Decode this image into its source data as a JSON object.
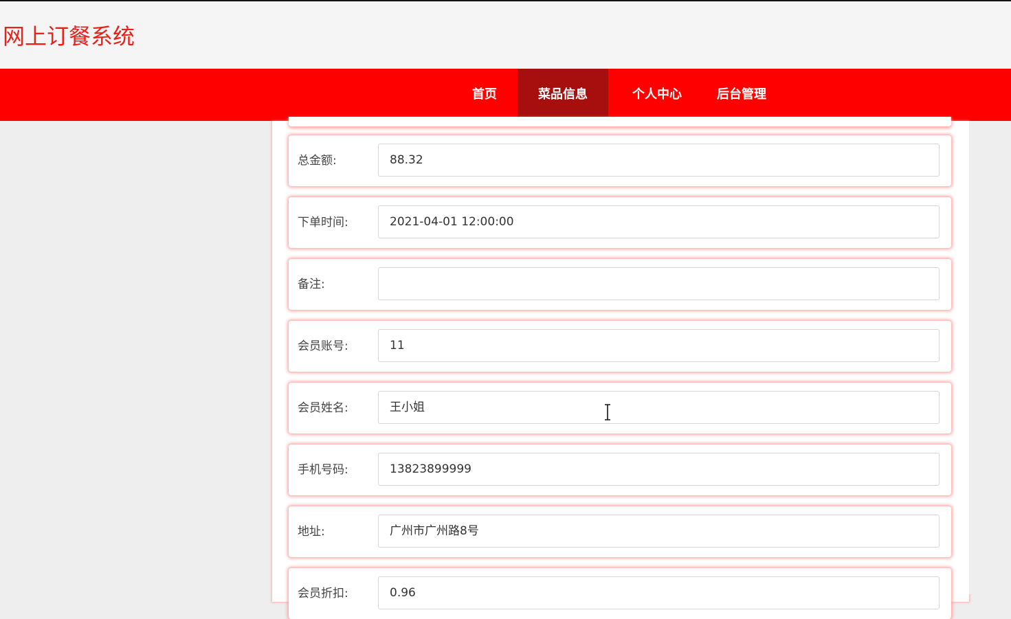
{
  "header": {
    "site_title": "网上订餐系统"
  },
  "nav": {
    "items": [
      {
        "label": "首页",
        "active": false
      },
      {
        "label": "菜品信息",
        "active": true
      },
      {
        "label": "个人中心",
        "active": false
      },
      {
        "label": "后台管理",
        "active": false
      }
    ]
  },
  "form": {
    "rows": [
      {
        "label": "总金额:",
        "value": "88.32"
      },
      {
        "label": "下单时间:",
        "value": "2021-04-01 12:00:00"
      },
      {
        "label": "备注:",
        "value": ""
      },
      {
        "label": "会员账号:",
        "value": "11"
      },
      {
        "label": "会员姓名:",
        "value": "王小姐"
      },
      {
        "label": "手机号码:",
        "value": "13823899999"
      },
      {
        "label": "地址:",
        "value": "广州市广州路8号"
      },
      {
        "label": "会员折扣:",
        "value": "0.96"
      }
    ]
  },
  "colors": {
    "accent": "#ff0000",
    "nav_active": "#a70f0f",
    "title": "#e8211a"
  }
}
